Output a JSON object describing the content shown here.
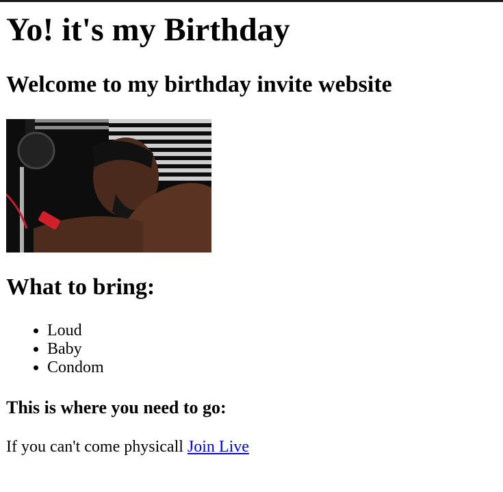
{
  "page": {
    "heading": "Yo! it's my Birthday",
    "welcome": "Welcome to my birthday invite website",
    "photo_alt": "person-photo"
  },
  "bring": {
    "heading": "What to bring:",
    "items": [
      "Loud",
      "Baby",
      "Condom"
    ]
  },
  "location": {
    "heading": "This is where you need to go:",
    "text": "If you can't come physicall ",
    "link_label": "Join Live"
  },
  "colors": {
    "link": "#0000ee",
    "text": "#000000",
    "background": "#ffffff"
  }
}
